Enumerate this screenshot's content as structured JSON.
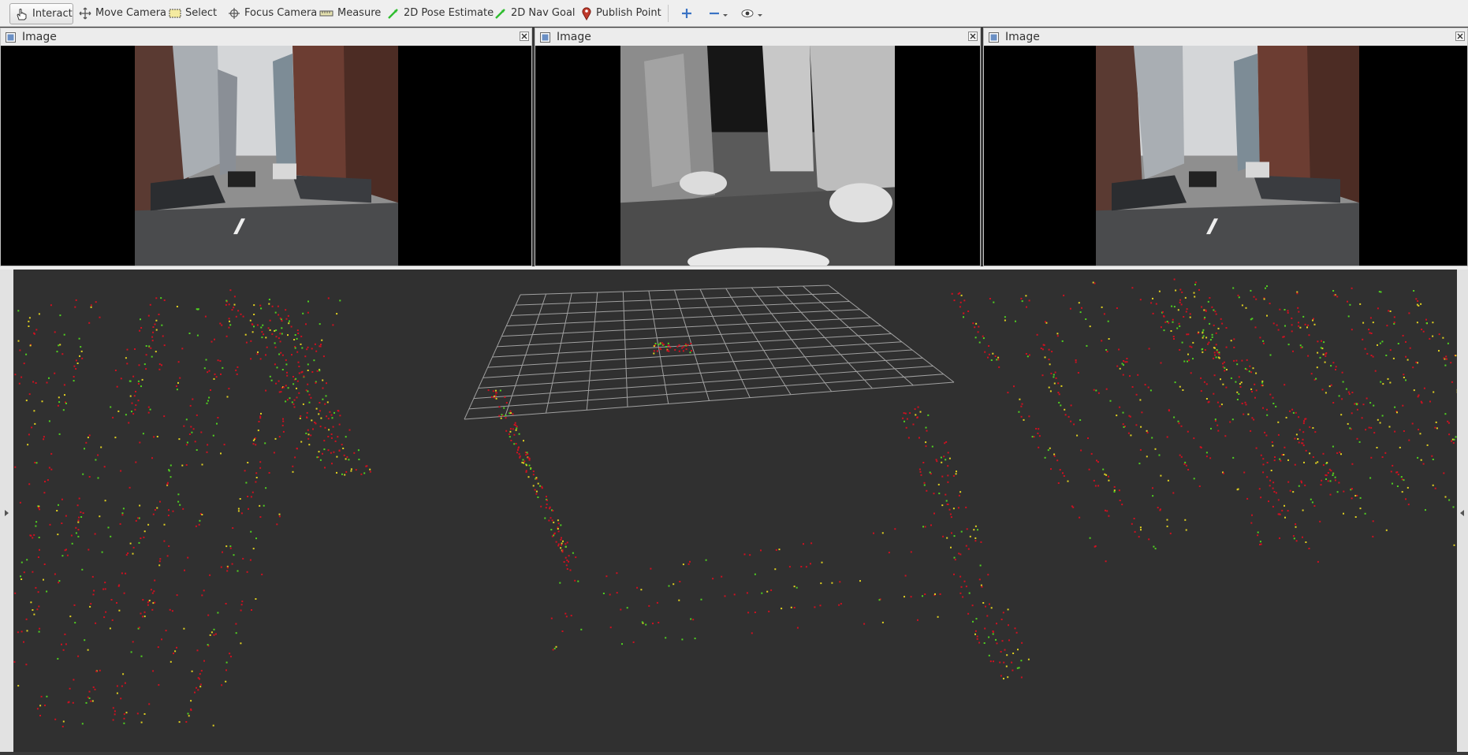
{
  "toolbar": {
    "tools": [
      {
        "label": "Interact",
        "icon": "hand-pointer-icon",
        "active": true
      },
      {
        "label": "Move Camera",
        "icon": "move-arrows-icon"
      },
      {
        "label": "Select",
        "icon": "select-rect-icon"
      },
      {
        "label": "Focus Camera",
        "icon": "focus-target-icon"
      },
      {
        "label": "Measure",
        "icon": "ruler-icon"
      },
      {
        "label": "2D Pose Estimate",
        "icon": "green-arrow-icon"
      },
      {
        "label": "2D Nav Goal",
        "icon": "green-arrow-icon"
      },
      {
        "label": "Publish Point",
        "icon": "map-pin-icon"
      }
    ],
    "extra_icons": [
      "add-tool-icon",
      "remove-tool-icon",
      "camera-view-icon"
    ]
  },
  "panels": [
    {
      "title": "Image",
      "kind": "color-camera"
    },
    {
      "title": "Image",
      "kind": "thermal-camera"
    },
    {
      "title": "Image",
      "kind": "color-camera"
    }
  ],
  "viewport": {
    "kind": "3d-point-cloud",
    "background": "#303030",
    "grid_color": "#a0a0a0"
  },
  "colors": {
    "toolbar_bg": "#efefef",
    "panel_bg": "#ececec",
    "point_red": "#d01020",
    "point_green": "#50d020",
    "point_yellow": "#e0d020"
  }
}
